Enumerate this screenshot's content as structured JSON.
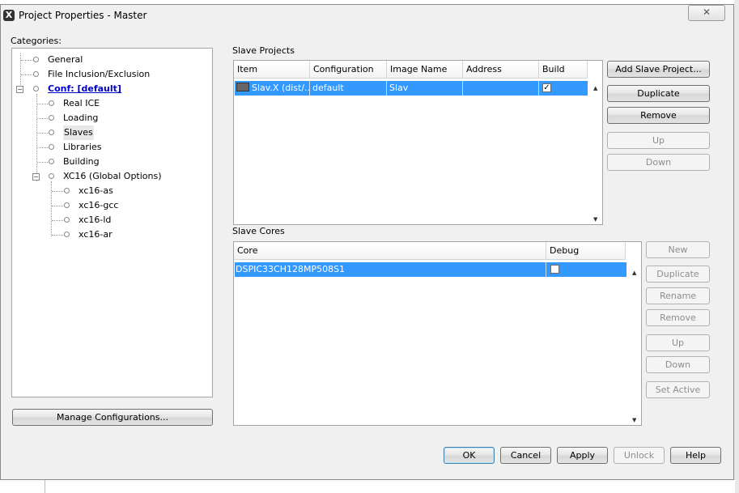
{
  "window": {
    "title": "Project Properties - Master",
    "close_glyph": "✕",
    "app_icon_glyph": "X"
  },
  "categories": {
    "label": "Categories:",
    "items": [
      {
        "label": "General"
      },
      {
        "label": "File Inclusion/Exclusion"
      },
      {
        "label": "Conf: [default]"
      },
      {
        "label": "Real ICE"
      },
      {
        "label": "Loading"
      },
      {
        "label": "Slaves"
      },
      {
        "label": "Libraries"
      },
      {
        "label": "Building"
      },
      {
        "label": "XC16 (Global Options)"
      },
      {
        "label": "xc16-as"
      },
      {
        "label": "xc16-gcc"
      },
      {
        "label": "xc16-ld"
      },
      {
        "label": "xc16-ar"
      }
    ],
    "manage_button": "Manage Configurations..."
  },
  "slave_projects": {
    "label": "Slave Projects",
    "columns": [
      "Item",
      "Configuration",
      "Image Name",
      "Address",
      "Build"
    ],
    "rows": [
      {
        "item": "Slav.X (dist/...",
        "configuration": "default",
        "image_name": "Slav",
        "address": "",
        "build": true
      }
    ],
    "buttons": {
      "add": "Add Slave Project...",
      "duplicate": "Duplicate",
      "remove": "Remove",
      "up": "Up",
      "down": "Down"
    }
  },
  "slave_cores": {
    "label": "Slave Cores",
    "columns": [
      "Core",
      "Debug"
    ],
    "rows": [
      {
        "core": "DSPIC33CH128MP508S1",
        "debug": false
      }
    ],
    "buttons": {
      "new": "New",
      "duplicate": "Duplicate",
      "rename": "Rename",
      "remove": "Remove",
      "up": "Up",
      "down": "Down",
      "set_active": "Set Active"
    }
  },
  "footer": {
    "ok": "OK",
    "cancel": "Cancel",
    "apply": "Apply",
    "unlock": "Unlock",
    "help": "Help"
  },
  "colors": {
    "selection": "#3399ff",
    "link": "#0000cc"
  }
}
